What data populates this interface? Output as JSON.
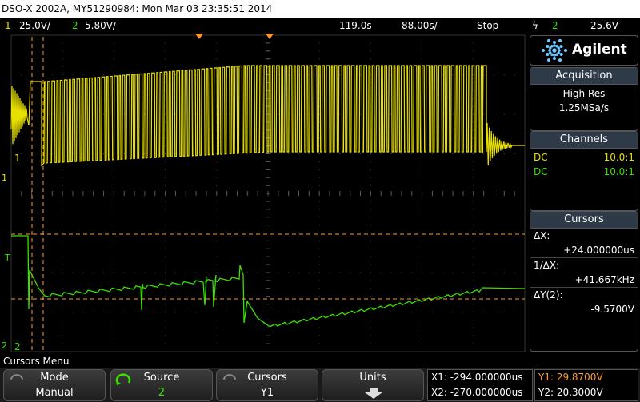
{
  "titlebar": {
    "text": "DSO-X 2002A, MY51290984: Mon Mar 03 23:35:51 2014"
  },
  "status": {
    "ch1_num": "1",
    "ch1_scale": "25.0V/",
    "ch2_num": "2",
    "ch2_scale": "5.80V/",
    "time_pos": "119.0s",
    "time_scale": "88.00s/",
    "run_state": "Stop",
    "trig_icon": "ϟ",
    "trig_ch": "2",
    "trig_level": "25.6V"
  },
  "brand": {
    "name": "Agilent",
    "logo_icon": "agilent-spark-icon"
  },
  "acquisition": {
    "header": "Acquisition",
    "mode": "High Res",
    "rate": "1.25MSa/s"
  },
  "channels": {
    "header": "Channels",
    "rows": [
      {
        "coupling": "DC",
        "probe": "10.0:1",
        "color": "#e8e000"
      },
      {
        "coupling": "DC",
        "probe": "10.0:1",
        "color": "#39e000"
      }
    ]
  },
  "cursors": {
    "header": "Cursors",
    "dx_label": "ΔX:",
    "dx_value": "+24.000000us",
    "inv_label": "1/ΔX:",
    "inv_value": "+41.667kHz",
    "dy_label": "ΔY(2):",
    "dy_value": "-9.5700V"
  },
  "screen_markers": {
    "ch1_marker": "1",
    "ch1_label": "1",
    "ch2_marker": "2",
    "ch2_label": "2",
    "trigger_marker": "T"
  },
  "menu": {
    "title": "Cursors Menu"
  },
  "softkeys": [
    {
      "top": "Mode",
      "bottom": "Manual"
    },
    {
      "top": "Source",
      "bottom": "2"
    },
    {
      "top": "Cursors",
      "bottom": "Y1"
    },
    {
      "top": "Units",
      "bottom": ""
    }
  ],
  "readouts": {
    "x1": "X1: -294.000000us",
    "x2": "X2: -270.000000us",
    "y1": "Y1: 29.8700V",
    "y2": "Y2: 20.3000V"
  },
  "colors": {
    "ch1": "#e8e000",
    "ch2": "#39e000",
    "cursor": "#ff9a2e",
    "grid": "#5a5a5a"
  }
}
